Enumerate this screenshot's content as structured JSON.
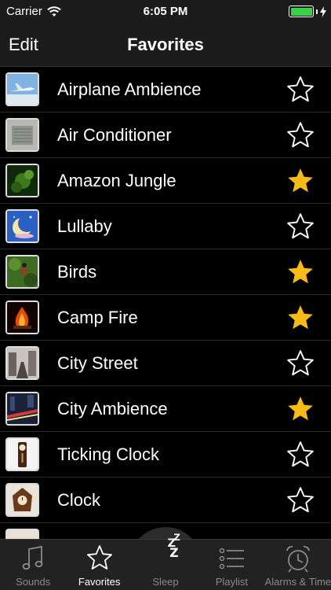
{
  "status": {
    "carrier": "Carrier",
    "time": "6:05 PM",
    "battery_color": "#35d24a"
  },
  "nav": {
    "edit_label": "Edit",
    "title": "Favorites"
  },
  "rows": [
    {
      "label": "Airplane Ambience",
      "favorite": false,
      "thumb": "airplane"
    },
    {
      "label": "Air Conditioner",
      "favorite": false,
      "thumb": "air-conditioner"
    },
    {
      "label": "Amazon Jungle",
      "favorite": true,
      "thumb": "jungle"
    },
    {
      "label": "Lullaby",
      "favorite": false,
      "thumb": "moon"
    },
    {
      "label": "Birds",
      "favorite": true,
      "thumb": "bird"
    },
    {
      "label": "Camp Fire",
      "favorite": true,
      "thumb": "fire"
    },
    {
      "label": "City Street",
      "favorite": false,
      "thumb": "city-street"
    },
    {
      "label": "City Ambience",
      "favorite": true,
      "thumb": "city-night"
    },
    {
      "label": "Ticking Clock",
      "favorite": false,
      "thumb": "grandfather-clock"
    },
    {
      "label": "Clock",
      "favorite": false,
      "thumb": "cuckoo-clock"
    }
  ],
  "colors": {
    "star_filled": "#f7bb17",
    "star_outline": "#ffffff",
    "tab_inactive": "#8a8a8a",
    "sleep_moon": "#f2c94c"
  },
  "tabs": [
    {
      "label": "Sounds",
      "icon": "music-note-icon",
      "active": false
    },
    {
      "label": "Favorites",
      "icon": "star-icon",
      "active": true
    },
    {
      "label": "Sleep",
      "icon": "moon-zzz-icon",
      "active": false
    },
    {
      "label": "Playlist",
      "icon": "list-icon",
      "active": false
    },
    {
      "label": "Alarms & Timers",
      "icon": "alarm-clock-icon",
      "active": false
    }
  ]
}
